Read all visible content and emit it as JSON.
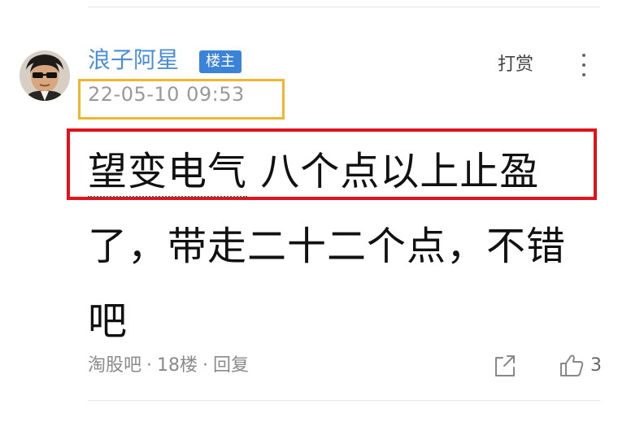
{
  "post": {
    "username": "浪子阿星",
    "role_badge": "楼主",
    "tip_label": "打赏",
    "more_icon": "more-vertical-icon",
    "timestamp": "22-05-10 09:53",
    "content": {
      "stock_name": "望变电气",
      "text_after_stock": " 八个点以上止盈了，带走二十二个点，不错吧"
    },
    "footer": {
      "source": "淘股吧",
      "separator": "·",
      "floor": "18楼",
      "reply_label": "回复"
    },
    "share_icon": "share-icon",
    "like_icon": "thumbs-up-icon",
    "like_count": "3"
  },
  "colors": {
    "username": "#4a8fd6",
    "badge_bg": "#3b82d9",
    "timestamp_box": "#f2b531",
    "highlight_box": "#e0131d",
    "meta_text": "#8a8a8a"
  }
}
